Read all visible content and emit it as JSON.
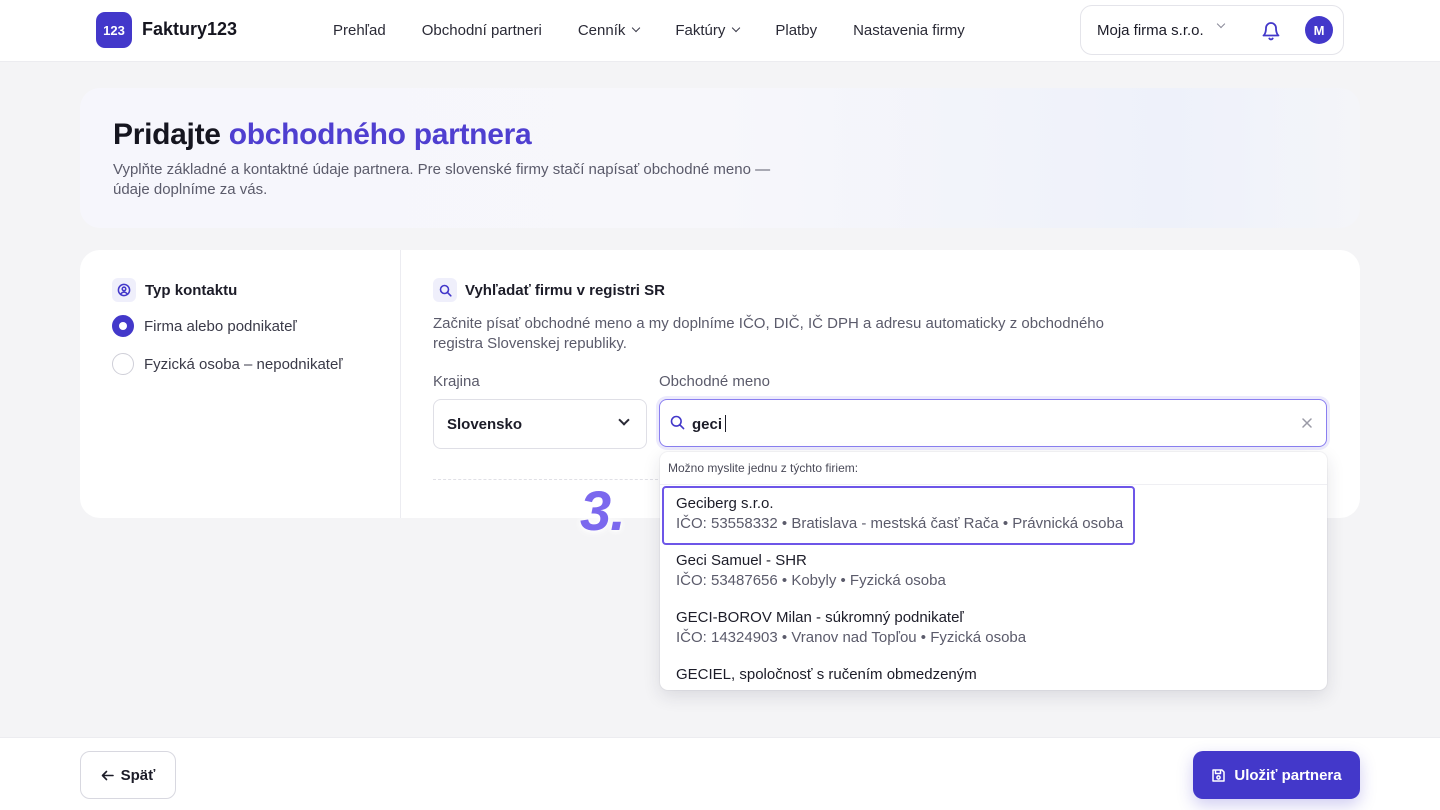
{
  "header": {
    "logo_badge": "123",
    "app_name": "Faktury123",
    "nav": [
      {
        "label": "Prehľad",
        "has_dropdown": false
      },
      {
        "label": "Obchodní partneri",
        "has_dropdown": false
      },
      {
        "label": "Cenník",
        "has_dropdown": true
      },
      {
        "label": "Faktúry",
        "has_dropdown": true
      },
      {
        "label": "Platby",
        "has_dropdown": false
      },
      {
        "label": "Nastavenia firmy",
        "has_dropdown": false
      }
    ],
    "company_selector": "Moja firma s.r.o.",
    "avatar_initial": "M",
    "icons": {
      "notifications": "bell-icon"
    }
  },
  "hero": {
    "title_prefix": "Pridajte ",
    "title_accent": "obchodného partnera",
    "subtitle": "Vyplňte základné a kontaktné údaje partnera. Pre slovenské firmy stačí napísať obchodné meno — údaje doplníme za vás."
  },
  "contact_type": {
    "title": "Typ kontaktu",
    "options": [
      {
        "label": "Firma alebo podnikateľ",
        "selected": true
      },
      {
        "label": "Fyzická osoba – nepodnikateľ",
        "selected": false
      }
    ]
  },
  "registry_search": {
    "title": "Vyhľadať firmu v registri SR",
    "help": "Začnite písať obchodné meno a my doplníme IČO, DIČ, IČ DPH a adresu automaticky z obchodného registra Slovenskej republiky.",
    "country_label": "Krajina",
    "country_value": "Slovensko",
    "name_label": "Obchodné meno",
    "name_value": "geci",
    "dropdown_hint": "Možno myslite jednu z týchto firiem:",
    "results": [
      {
        "name": "Geciberg s.r.o.",
        "meta": "IČO: 53558332 • Bratislava - mestská časť Rača • Právnická osoba",
        "highlighted": true
      },
      {
        "name": "Geci Samuel - SHR",
        "meta": "IČO: 53487656 • Kobyly • Fyzická osoba",
        "highlighted": false
      },
      {
        "name": "GECI-BOROV Milan - súkromný podnikateľ",
        "meta": "IČO: 14324903 • Vranov nad Topľou • Fyzická osoba",
        "highlighted": false
      },
      {
        "name": "GECIEL, spoločnosť s ručením obmedzeným",
        "meta": "",
        "highlighted": false
      }
    ]
  },
  "step_marker": "3.",
  "footer": {
    "back_label": "Späť",
    "save_label": "Uložiť partnera"
  },
  "colors": {
    "accent": "#4338ca",
    "accent_text": "#4f3fd0",
    "highlight_border": "#6d56e8"
  }
}
